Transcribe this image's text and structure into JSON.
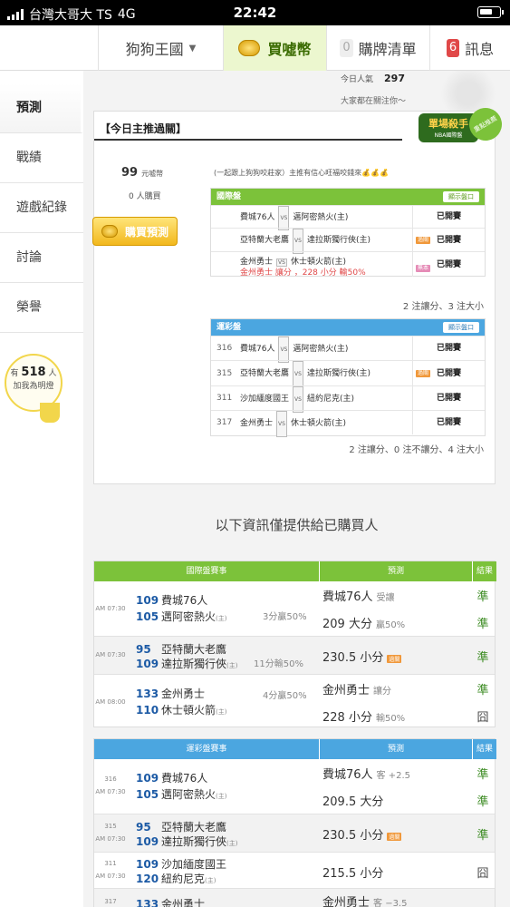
{
  "status_bar": {
    "carrier": "台灣大哥大 TS",
    "network": "4G",
    "time": "22:42"
  },
  "nav": {
    "dropdown": "狗狗王國",
    "buy": "買噓幣",
    "cart_count": "0",
    "cart": "購牌清單",
    "msg_count": "6",
    "msg": "訊息"
  },
  "sidebar": [
    "預測",
    "戰績",
    "遊戲紀錄",
    "討論",
    "榮譽"
  ],
  "fan": {
    "prefix": "有",
    "count": "518",
    "unit": "人",
    "line": "加我為明燈"
  },
  "popularity": {
    "label": "今日人氣",
    "value": "297",
    "note": "大家都在關注你～"
  },
  "badge": {
    "title": "單場殺手",
    "sub": "NBA國際盤",
    "corner": "重點推薦"
  },
  "today": {
    "title": "【今日主推過關】",
    "price": "99",
    "price_unit": "元噓幣",
    "buyers": "0",
    "buyers_unit": "人購買",
    "buy_btn": "購買預測",
    "slogan": "(一起跟上狗狗咬莊家）主推有信心旺福咬錢來💰💰💰"
  },
  "intl": {
    "header": "國際盤",
    "toggle": "顯示盤口",
    "rows": [
      {
        "home": "費城76人",
        "away": "邁阿密熱火(主)",
        "status": "已開賽"
      },
      {
        "home": "亞特蘭大老鷹",
        "away": "達拉斯獨行俠(主)",
        "tag": "過關",
        "status": "已開賽"
      },
      {
        "home": "金州勇士",
        "away": "休士頓火箭(主)",
        "pick": "金州勇士  讓分 ，228 小分  輸50%",
        "tag": "無本",
        "status": "已開賽"
      }
    ],
    "summary": "2 注讓分、3 注大小"
  },
  "lottery": {
    "header": "運彩盤",
    "toggle": "顯示盤口",
    "rows": [
      {
        "no": "316",
        "home": "費城76人",
        "away": "邁阿密熱火(主)",
        "status": "已開賽"
      },
      {
        "no": "315",
        "home": "亞特蘭大老鷹",
        "away": "達拉斯獨行俠(主)",
        "tag": "過關",
        "status": "已開賽"
      },
      {
        "no": "311",
        "home": "沙加緬度國王",
        "away": "紐約尼克(主)",
        "status": "已開賽"
      },
      {
        "no": "317",
        "home": "金州勇士",
        "away": "休士頓火箭(主)",
        "status": "已開賽"
      }
    ],
    "summary": "2 注讓分、0 注不讓分、4 注大小"
  },
  "info_title": "以下資訊僅提供給已購買人",
  "intl_detail": {
    "h1": "國際盤賽事",
    "h2": "預測",
    "h3": "結果",
    "games": [
      {
        "time": "AM 07:30",
        "t1n": "109",
        "t1": "費城76人",
        "t2n": "105",
        "t2": "邁阿密熱火",
        "note": "3分贏50%",
        "p1": "費城76人",
        "p1s": "受讓",
        "r1": "準",
        "p2": "209 大分",
        "p2s": "贏50%",
        "r2": "準"
      },
      {
        "time": "AM 07:30",
        "t1n": "95",
        "t1": "亞特蘭大老鷹",
        "t2n": "109",
        "t2": "達拉斯獨行俠",
        "note": "11分輸50%",
        "p1": "230.5 小分",
        "tag": "過關",
        "r1": "準"
      },
      {
        "time": "AM 08:00",
        "t1n": "133",
        "t1": "金州勇士",
        "t2n": "110",
        "t2": "休士頓火箭",
        "note": "4分贏50%",
        "p1": "金州勇士",
        "p1s": "讓分",
        "r1": "準",
        "p2": "228 小分",
        "p2s": "輸50%",
        "r2": "囧"
      }
    ]
  },
  "lot_detail": {
    "h1": "運彩盤賽事",
    "h2": "預測",
    "h3": "結果",
    "games": [
      {
        "no": "316",
        "time": "AM 07:30",
        "t1n": "109",
        "t1": "費城76人",
        "t2n": "105",
        "t2": "邁阿密熱火",
        "p1": "費城76人",
        "p1s": "客 +2.5",
        "r1": "準",
        "p2": "209.5 大分",
        "r2": "準"
      },
      {
        "no": "315",
        "time": "AM 07:30",
        "t1n": "95",
        "t1": "亞特蘭大老鷹",
        "t2n": "109",
        "t2": "達拉斯獨行俠",
        "p1": "230.5 小分",
        "tag": "過關",
        "r1": "準"
      },
      {
        "no": "311",
        "time": "AM 07:30",
        "t1n": "109",
        "t1": "沙加緬度國王",
        "t2n": "120",
        "t2": "紐約尼克",
        "p1": "215.5 小分",
        "r1": "囧"
      },
      {
        "no": "317",
        "t1n": "133",
        "t1": "金州勇士",
        "p1": "金州勇士",
        "p1s": "客 −3.5"
      }
    ]
  },
  "home_mark": "(主)",
  "colors": {
    "green": "#7cc23a",
    "blue": "#4ba6e0",
    "pass": "#3a8a20"
  }
}
